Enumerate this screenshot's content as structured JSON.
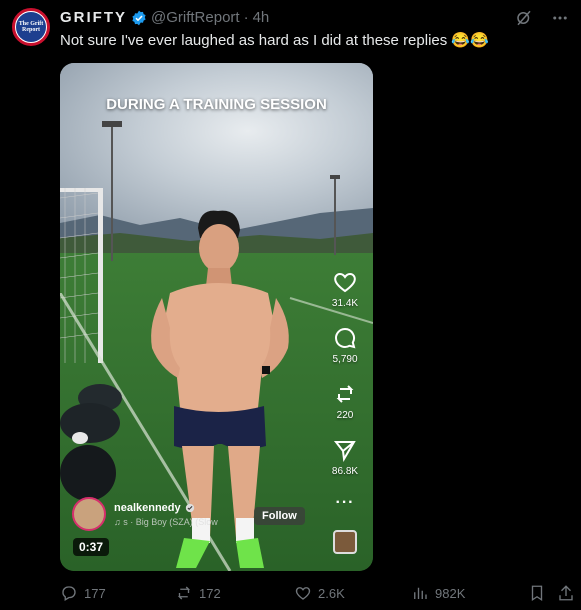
{
  "post": {
    "author_name": "GRIFTY",
    "handle": "@GriftReport",
    "separator": "·",
    "time": "4h",
    "text": "Not sure I've ever laughed as hard as I did at these replies 😂😂",
    "avatar_text": "The Grift Report"
  },
  "video": {
    "overlay_title": "DURING A TRAINING SESSION",
    "likes": "31.4K",
    "comments": "5,790",
    "reposts": "220",
    "shares": "86.8K",
    "creator": "nealkennedy",
    "song": "♫ s · Big Boy (SZA) (Slow",
    "follow_label": "Follow",
    "duration": "0:37"
  },
  "actions": {
    "replies": "177",
    "reposts": "172",
    "likes": "2.6K",
    "views": "982K"
  },
  "colors": {
    "accent": "#1d9bf0",
    "text": "#e7e9ea",
    "muted": "#71767b",
    "background": "#000000"
  }
}
